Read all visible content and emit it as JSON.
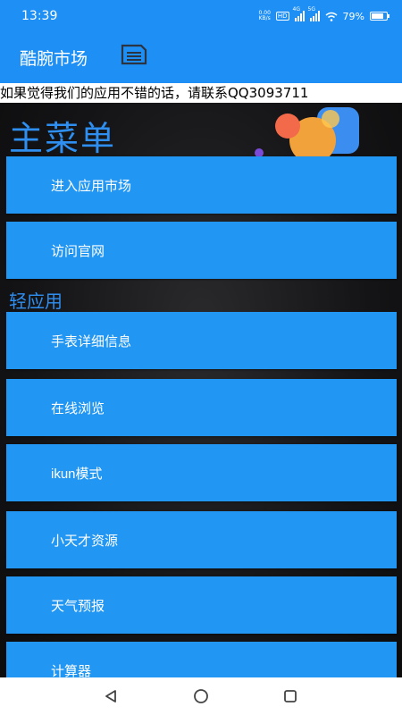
{
  "status_bar": {
    "time": "13:39",
    "net_speed_value": "0.00",
    "net_speed_unit": "KB/s",
    "hd_badge": "HD",
    "sig1_label": "4G",
    "sig2_label": "5G",
    "battery": "79%",
    "battery_level": 0.79
  },
  "app_bar": {
    "title": "酷腕市场",
    "menu_icon": "menu-list-icon"
  },
  "banner": {
    "text": "如果觉得我们的应用不错的话，请联系QQ3093711"
  },
  "main": {
    "title": "主菜单",
    "items": [
      {
        "label": "进入应用市场"
      },
      {
        "label": "访问官网"
      }
    ]
  },
  "light_apps": {
    "title": "轻应用",
    "items": [
      {
        "label": "手表详细信息"
      },
      {
        "label": "在线浏览"
      },
      {
        "label": "ikun模式"
      },
      {
        "label": "小天才资源"
      },
      {
        "label": "天气预报"
      },
      {
        "label": "计算器"
      }
    ]
  },
  "nav_bar": {
    "back_icon": "back-triangle-icon",
    "home_icon": "home-circle-icon",
    "recents_icon": "recents-square-icon"
  },
  "colors": {
    "accent": "#1e90f5",
    "button": "#2196f3",
    "title_text": "#2f8ff0",
    "background": "#141416"
  }
}
